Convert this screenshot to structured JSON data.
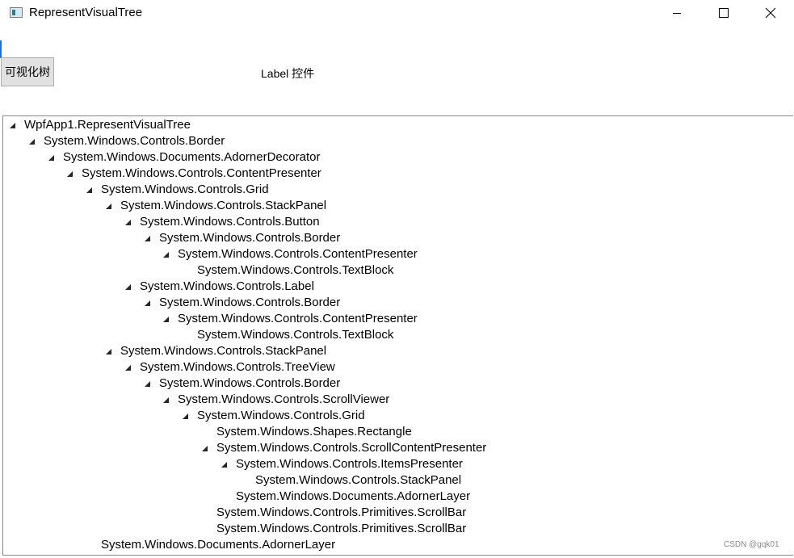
{
  "window": {
    "title": "RepresentVisualTree"
  },
  "toolbar": {
    "button_label": "可视化树",
    "label_text": "Label 控件"
  },
  "tree": {
    "items": [
      {
        "text": "WpfApp1.RepresentVisualTree",
        "level": 0,
        "expanded": true
      },
      {
        "text": "System.Windows.Controls.Border",
        "level": 1,
        "expanded": true
      },
      {
        "text": "System.Windows.Documents.AdornerDecorator",
        "level": 2,
        "expanded": true
      },
      {
        "text": "System.Windows.Controls.ContentPresenter",
        "level": 3,
        "expanded": true
      },
      {
        "text": "System.Windows.Controls.Grid",
        "level": 4,
        "expanded": true
      },
      {
        "text": "System.Windows.Controls.StackPanel",
        "level": 5,
        "expanded": true
      },
      {
        "text": "System.Windows.Controls.Button",
        "level": 6,
        "expanded": true
      },
      {
        "text": "System.Windows.Controls.Border",
        "level": 7,
        "expanded": true
      },
      {
        "text": "System.Windows.Controls.ContentPresenter",
        "level": 8,
        "expanded": true
      },
      {
        "text": "System.Windows.Controls.TextBlock",
        "level": 9,
        "expanded": false
      },
      {
        "text": "System.Windows.Controls.Label",
        "level": 6,
        "expanded": true
      },
      {
        "text": "System.Windows.Controls.Border",
        "level": 7,
        "expanded": true
      },
      {
        "text": "System.Windows.Controls.ContentPresenter",
        "level": 8,
        "expanded": true
      },
      {
        "text": "System.Windows.Controls.TextBlock",
        "level": 9,
        "expanded": false
      },
      {
        "text": "System.Windows.Controls.StackPanel",
        "level": 5,
        "expanded": true
      },
      {
        "text": "System.Windows.Controls.TreeView",
        "level": 6,
        "expanded": true
      },
      {
        "text": "System.Windows.Controls.Border",
        "level": 7,
        "expanded": true
      },
      {
        "text": "System.Windows.Controls.ScrollViewer",
        "level": 8,
        "expanded": true
      },
      {
        "text": "System.Windows.Controls.Grid",
        "level": 9,
        "expanded": true
      },
      {
        "text": "System.Windows.Shapes.Rectangle",
        "level": 10,
        "expanded": false
      },
      {
        "text": "System.Windows.Controls.ScrollContentPresenter",
        "level": 10,
        "expanded": true
      },
      {
        "text": "System.Windows.Controls.ItemsPresenter",
        "level": 11,
        "expanded": true
      },
      {
        "text": "System.Windows.Controls.StackPanel",
        "level": 12,
        "expanded": false
      },
      {
        "text": "System.Windows.Documents.AdornerLayer",
        "level": 11,
        "expanded": false
      },
      {
        "text": "System.Windows.Controls.Primitives.ScrollBar",
        "level": 10,
        "expanded": false
      },
      {
        "text": "System.Windows.Controls.Primitives.ScrollBar",
        "level": 10,
        "expanded": false
      },
      {
        "text": "System.Windows.Documents.AdornerLayer",
        "level": 4,
        "expanded": false
      }
    ]
  },
  "watermark": "CSDN @gqk01",
  "colors": {
    "tree_border": "#828790",
    "button_bg": "#e1e1e1",
    "button_border": "#adadad",
    "arrow": "#262626",
    "accent_strip": "#1e6fd9"
  },
  "icons": {
    "app": "window-app-icon",
    "minimize": "minimize-icon",
    "maximize": "maximize-icon",
    "close": "close-icon",
    "expander": "expanded-triangle-icon"
  }
}
